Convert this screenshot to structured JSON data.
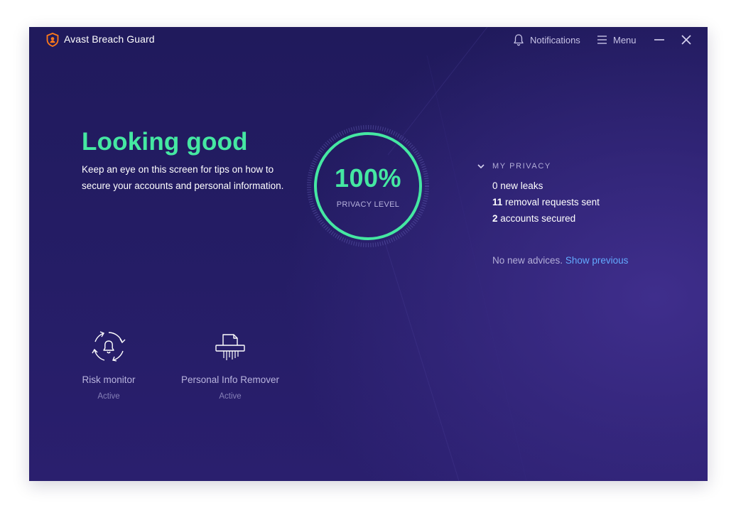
{
  "app": {
    "title": "Avast Breach Guard",
    "logo_icon": "avast-shield-icon"
  },
  "titlebar": {
    "notifications_label": "Notifications",
    "menu_label": "Menu",
    "minimize_icon": "minimize-icon",
    "close_icon": "close-icon"
  },
  "status": {
    "title": "Looking good",
    "description": "Keep an eye on this screen for tips on how to secure your accounts and personal information."
  },
  "gauge": {
    "value": "100%",
    "label": "PRIVACY LEVEL",
    "fraction": 1.0
  },
  "privacy": {
    "header": "MY PRIVACY",
    "stats": [
      {
        "count": "0",
        "text": "new leaks"
      },
      {
        "count": "11",
        "text": "removal requests sent"
      },
      {
        "count": "2",
        "text": "accounts secured"
      }
    ],
    "advice_text": "No new advices.",
    "advice_link": "Show previous"
  },
  "features": [
    {
      "name": "Risk monitor",
      "status": "Active",
      "icon": "risk-monitor-bell-icon"
    },
    {
      "name": "Personal Info Remover",
      "status": "Active",
      "icon": "document-shredder-icon"
    }
  ],
  "colors": {
    "background": "#221b60",
    "accent_green": "#45e8a2",
    "link_blue": "#63aaff",
    "logo_orange": "#ff7a1a"
  }
}
